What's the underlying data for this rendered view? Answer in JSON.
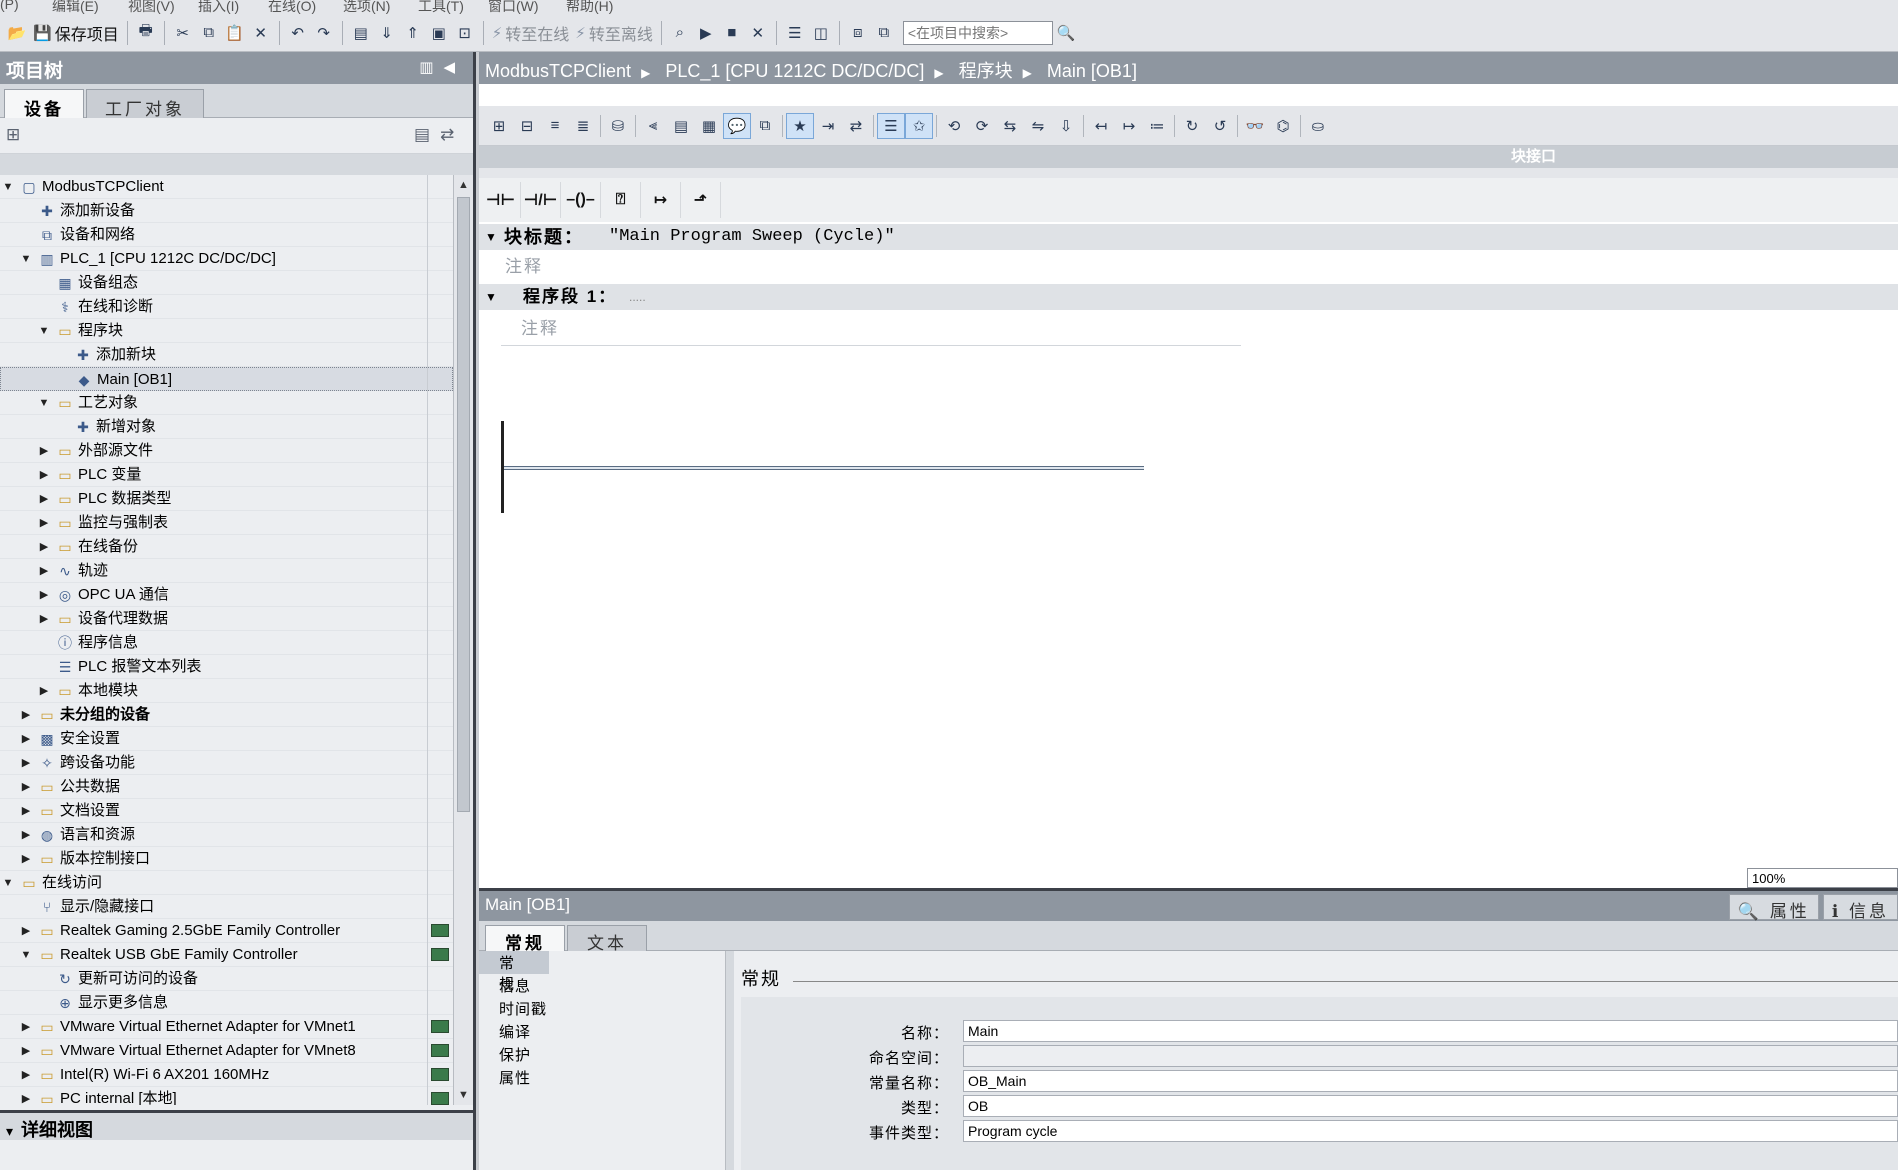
{
  "menu": [
    "(P)",
    "编辑(E)",
    "视图(V)",
    "插入(I)",
    "在线(O)",
    "选项(N)",
    "工具(T)",
    "窗口(W)",
    "帮助(H)"
  ],
  "toolbar": {
    "save_label": "保存项目",
    "go_online": "转至在线",
    "go_offline": "转至离线",
    "search_placeholder": "<在项目中搜索>"
  },
  "project_tree": {
    "title": "项目树",
    "tabs": [
      "设备",
      "工厂对象"
    ],
    "items": [
      {
        "label": "ModbusTCPClient",
        "level": 0,
        "arrow": "down",
        "icon": "project-icon"
      },
      {
        "label": "添加新设备",
        "level": 1,
        "arrow": "",
        "icon": "add-device-icon"
      },
      {
        "label": "设备和网络",
        "level": 1,
        "arrow": "",
        "icon": "network-icon"
      },
      {
        "label": "PLC_1 [CPU 1212C DC/DC/DC]",
        "level": 1,
        "arrow": "down",
        "icon": "plc-icon"
      },
      {
        "label": "设备组态",
        "level": 2,
        "arrow": "",
        "icon": "device-config-icon"
      },
      {
        "label": "在线和诊断",
        "level": 2,
        "arrow": "",
        "icon": "diagnostics-icon"
      },
      {
        "label": "程序块",
        "level": 2,
        "arrow": "down",
        "icon": "folder-icon"
      },
      {
        "label": "添加新块",
        "level": 3,
        "arrow": "",
        "icon": "add-block-icon"
      },
      {
        "label": "Main [OB1]",
        "level": 3,
        "arrow": "",
        "icon": "ob-icon",
        "selected": true
      },
      {
        "label": "工艺对象",
        "level": 2,
        "arrow": "down",
        "icon": "folder-icon"
      },
      {
        "label": "新增对象",
        "level": 3,
        "arrow": "",
        "icon": "add-object-icon"
      },
      {
        "label": "外部源文件",
        "level": 2,
        "arrow": "right",
        "icon": "folder-icon"
      },
      {
        "label": "PLC 变量",
        "level": 2,
        "arrow": "right",
        "icon": "folder-icon"
      },
      {
        "label": "PLC 数据类型",
        "level": 2,
        "arrow": "right",
        "icon": "folder-icon"
      },
      {
        "label": "监控与强制表",
        "level": 2,
        "arrow": "right",
        "icon": "folder-icon"
      },
      {
        "label": "在线备份",
        "level": 2,
        "arrow": "right",
        "icon": "folder-icon"
      },
      {
        "label": "轨迹",
        "level": 2,
        "arrow": "right",
        "icon": "trace-icon"
      },
      {
        "label": "OPC UA 通信",
        "level": 2,
        "arrow": "right",
        "icon": "opcua-icon"
      },
      {
        "label": "设备代理数据",
        "level": 2,
        "arrow": "right",
        "icon": "folder-icon"
      },
      {
        "label": "程序信息",
        "level": 2,
        "arrow": "",
        "icon": "info-icon"
      },
      {
        "label": "PLC 报警文本列表",
        "level": 2,
        "arrow": "",
        "icon": "list-icon"
      },
      {
        "label": "本地模块",
        "level": 2,
        "arrow": "right",
        "icon": "folder-icon"
      },
      {
        "label": "未分组的设备",
        "level": 1,
        "arrow": "right",
        "icon": "folder-icon",
        "bold": true
      },
      {
        "label": "安全设置",
        "level": 1,
        "arrow": "right",
        "icon": "security-icon"
      },
      {
        "label": "跨设备功能",
        "level": 1,
        "arrow": "right",
        "icon": "cross-device-icon"
      },
      {
        "label": "公共数据",
        "level": 1,
        "arrow": "right",
        "icon": "folder-icon"
      },
      {
        "label": "文档设置",
        "level": 1,
        "arrow": "right",
        "icon": "folder-icon"
      },
      {
        "label": "语言和资源",
        "level": 1,
        "arrow": "right",
        "icon": "language-icon"
      },
      {
        "label": "版本控制接口",
        "level": 1,
        "arrow": "right",
        "icon": "folder-icon"
      },
      {
        "label": "在线访问",
        "level": 0,
        "arrow": "down",
        "icon": "folder-icon"
      },
      {
        "label": "显示/隐藏接口",
        "level": 1,
        "arrow": "",
        "icon": "interface-icon"
      },
      {
        "label": "Realtek Gaming 2.5GbE Family Controller",
        "level": 1,
        "arrow": "right",
        "icon": "folder-icon",
        "adapter": true
      },
      {
        "label": "Realtek USB GbE Family Controller",
        "level": 1,
        "arrow": "down",
        "icon": "folder-icon",
        "adapter": true
      },
      {
        "label": "更新可访问的设备",
        "level": 2,
        "arrow": "",
        "icon": "refresh-icon"
      },
      {
        "label": "显示更多信息",
        "level": 2,
        "arrow": "",
        "icon": "more-info-icon"
      },
      {
        "label": "VMware Virtual Ethernet Adapter for VMnet1",
        "level": 1,
        "arrow": "right",
        "icon": "folder-icon",
        "adapter": true
      },
      {
        "label": "VMware Virtual Ethernet Adapter for VMnet8",
        "level": 1,
        "arrow": "right",
        "icon": "folder-icon",
        "adapter": true
      },
      {
        "label": "Intel(R) Wi-Fi 6 AX201 160MHz",
        "level": 1,
        "arrow": "right",
        "icon": "folder-icon",
        "adapter": true
      },
      {
        "label": "PC internal [本地]",
        "level": 1,
        "arrow": "right",
        "icon": "folder-icon",
        "adapter": true
      }
    ],
    "detail_view": "详细视图"
  },
  "editor": {
    "breadcrumb": [
      "ModbusTCPClient",
      "PLC_1 [CPU 1212C DC/DC/DC]",
      "程序块",
      "Main [OB1]"
    ],
    "block_interface": "块接口",
    "block_title_label": "块标题：",
    "block_title_value": "\"Main Program Sweep (Cycle)\"",
    "block_comment": "注释",
    "network_label": "程序段 1：",
    "network_dots": ".....",
    "network_comment": "注释",
    "zoom": "100%"
  },
  "properties": {
    "title": "Main [OB1]",
    "right_tabs": [
      "属性",
      "信息"
    ],
    "tabs": [
      "常规",
      "文本"
    ],
    "nav": [
      "常规",
      "信息",
      "时间戳",
      "编译",
      "保护",
      "属性"
    ],
    "section": "常规",
    "fields": [
      {
        "label": "名称：",
        "value": "Main"
      },
      {
        "label": "命名空间：",
        "value": ""
      },
      {
        "label": "常量名称：",
        "value": "OB_Main"
      },
      {
        "label": "类型：",
        "value": "OB"
      },
      {
        "label": "事件类型：",
        "value": "Program cycle"
      }
    ]
  }
}
